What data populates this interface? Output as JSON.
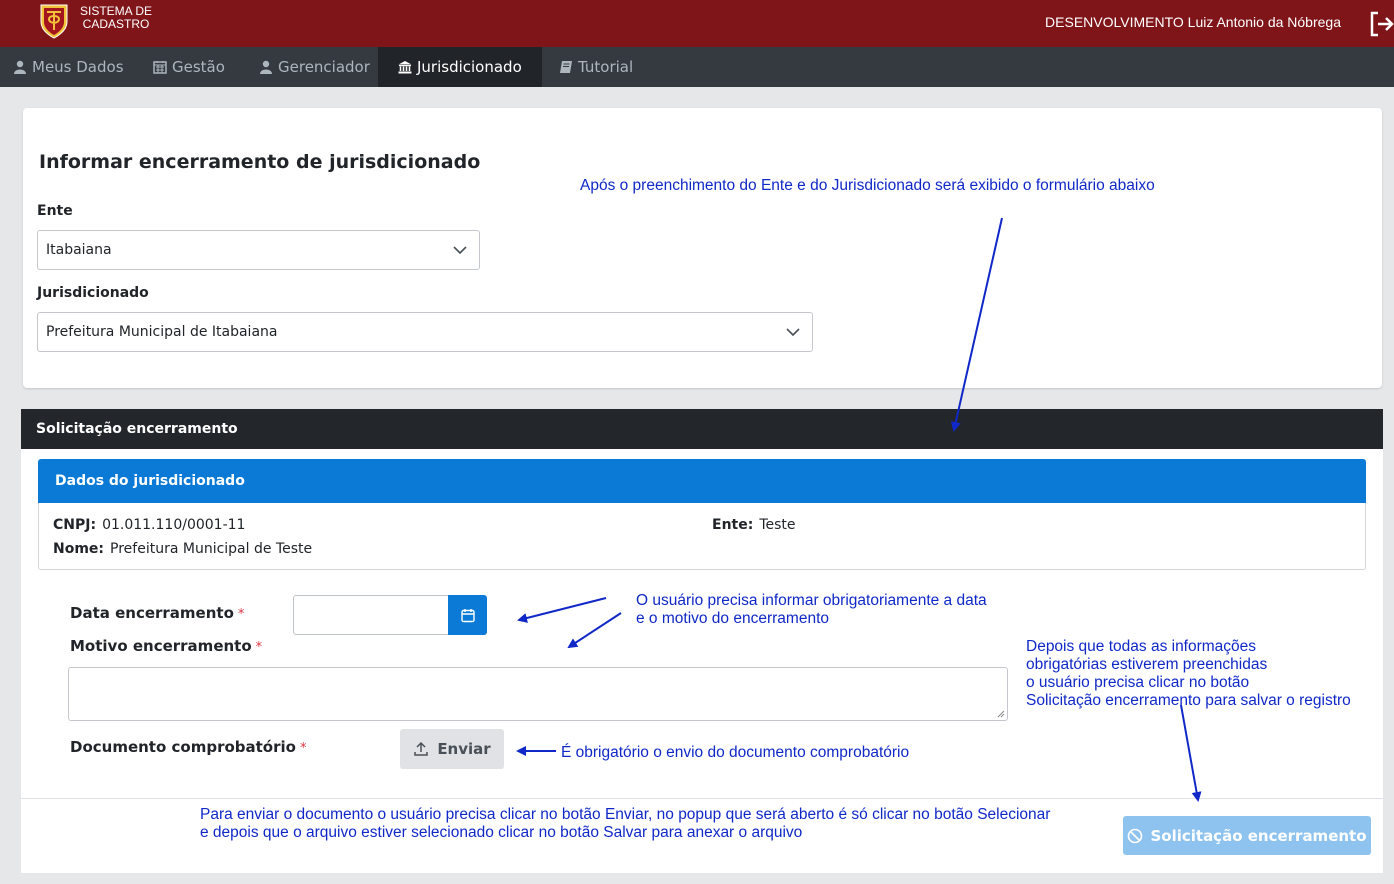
{
  "header": {
    "app_name_line1": "SISTEMA DE",
    "app_name_line2": "CADASTRO",
    "user": "DESENVOLVIMENTO Luiz Antonio da Nóbrega",
    "brand_color": "#7f1419"
  },
  "nav": {
    "items": [
      {
        "label": "Meus Dados",
        "icon": "user-icon"
      },
      {
        "label": "Gestão",
        "icon": "calendar-icon"
      },
      {
        "label": "Gerenciador",
        "icon": "user-icon"
      },
      {
        "label": "Jurisdicionado",
        "icon": "bank-icon",
        "active": true
      },
      {
        "label": "Tutorial",
        "icon": "book-icon"
      }
    ]
  },
  "form": {
    "title": "Informar encerramento de jurisdicionado",
    "ente_label": "Ente",
    "ente_value": "Itabaiana",
    "jurisdicionado_label": "Jurisdicionado",
    "jurisdicionado_value": "Prefeitura Municipal de Itabaiana"
  },
  "solicitacao": {
    "header": "Solicitação encerramento",
    "panel_title": "Dados do jurisdicionado",
    "cnpj_label": "CNPJ:",
    "cnpj_value": "01.011.110/0001-11",
    "nome_label": "Nome:",
    "nome_value": "Prefeitura Municipal de Teste",
    "ente_label": "Ente:",
    "ente_value": "Teste",
    "data_label": "Data encerramento",
    "motivo_label": "Motivo encerramento",
    "documento_label": "Documento comprobatório",
    "required_mark": "*",
    "upload_label": "Enviar",
    "submit_label": "Solicitação encerramento",
    "accent_color": "#0b7ad6"
  },
  "annotations": {
    "top": "Após o preenchimento do Ente e do Jurisdicionado será exibido o formulário abaixo",
    "date_line1": "O usuário precisa informar obrigatoriamente a data",
    "date_line2": "e o motivo do encerramento",
    "submit_line1": "Depois que todas as informações",
    "submit_line2": "obrigatórias estiverem preenchidas",
    "submit_line3": "o usuário precisa clicar no botão",
    "submit_line4": "Solicitação encerramento para salvar o registro",
    "upload": "É obrigatório o envio do documento comprobatório",
    "bottom_line1": "Para enviar o documento o usuário precisa clicar no botão Enviar, no popup que será aberto é só clicar no botão Selecionar",
    "bottom_line2": "e depois que o arquivo estiver selecionado clicar no botão Salvar para anexar o arquivo",
    "color": "#1028c8"
  }
}
